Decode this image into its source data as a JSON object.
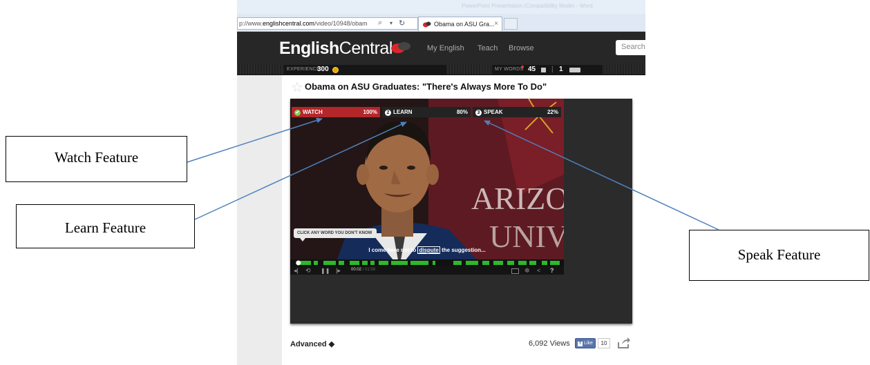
{
  "browser": {
    "titlebar_ghost": "PowerPoint Presentation (Compatibility Mode) - Word",
    "url_prefix": "p://www.",
    "url_host": "englishcentral.com",
    "url_path": "/video/10948/obam",
    "tab_title": "Obama on ASU Gra...",
    "tab_close": "×"
  },
  "site": {
    "logo_bold": "English",
    "logo_rest": "Central",
    "nav": [
      "My English",
      "Teach",
      "Browse"
    ],
    "search_placeholder": "Search",
    "experience_label": "EXPERIENCE:",
    "experience_value": "300",
    "my_words_label": "MY WORDS",
    "my_words_value": "45",
    "stat_separator": "|",
    "stat_count": "1"
  },
  "video": {
    "title": "Obama on ASU Graduates: \"There's Always More To Do\"",
    "steps": [
      {
        "number": "✔",
        "label": "WATCH",
        "percent": "100%"
      },
      {
        "number": "2",
        "label": "LEARN",
        "percent": "80%"
      },
      {
        "number": "3",
        "label": "SPEAK",
        "percent": "22%"
      }
    ],
    "backdrop_text_1": "ARIZO",
    "backdrop_text_2": "UNIV",
    "tooltip": "CLICK ANY WORD YOU DON'T KNOW",
    "caption_before": "I come here not to ",
    "caption_word": "dispute",
    "caption_after": " the suggestion...",
    "time_current": "00:02",
    "time_duration": "/ 01:58",
    "playback_progress": 0.02
  },
  "footer": {
    "level": "Advanced ◆",
    "views": "6,092 Views",
    "like_label": "Like",
    "like_count": "10"
  },
  "annotations": {
    "watch": "Watch Feature",
    "learn": "Learn Feature",
    "speak": "Speak Feature"
  },
  "colors": {
    "header_bg": "#272727",
    "watch_red": "#b3262a",
    "timeline_green": "#2db82a",
    "arrow_blue": "#4f81bd"
  }
}
